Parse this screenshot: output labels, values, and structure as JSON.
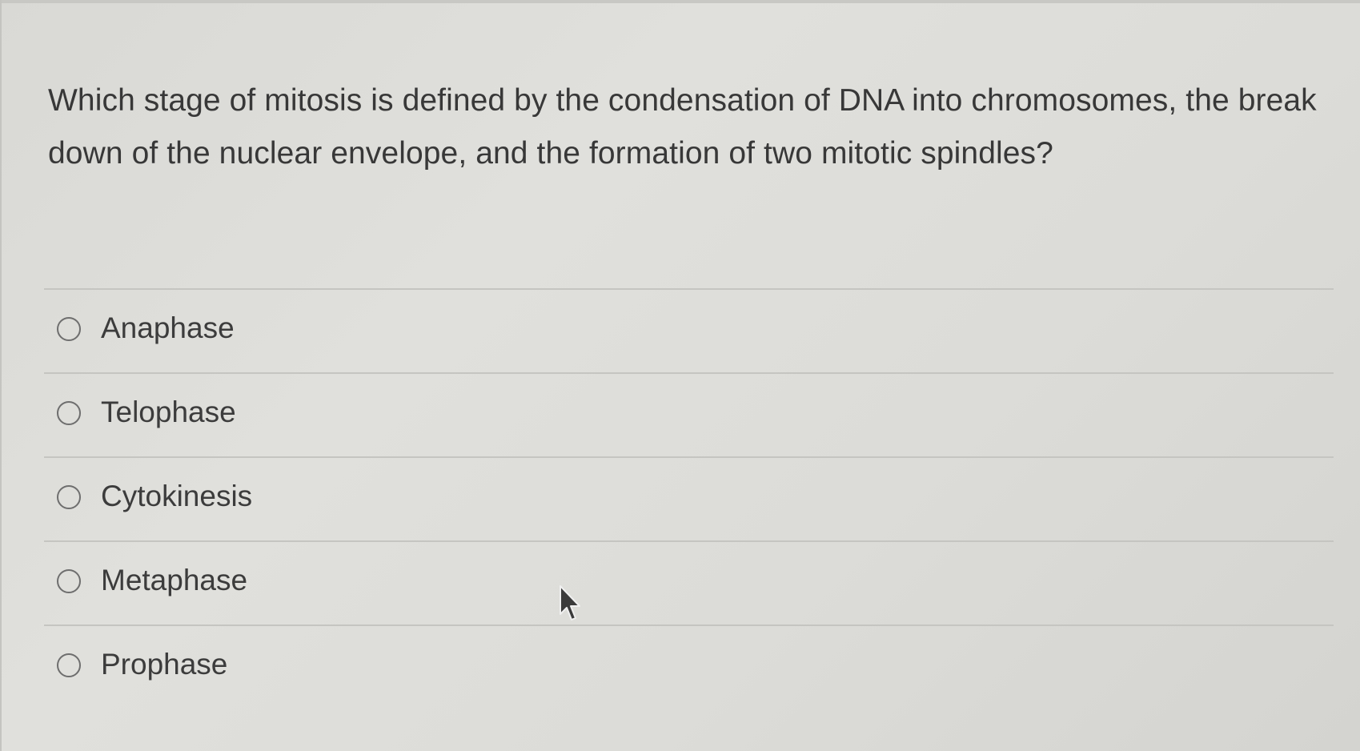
{
  "question": {
    "text": "Which stage of mitosis is defined by the condensation of DNA into chromosomes, the break down of the nuclear envelope, and the formation of two mitotic spindles?"
  },
  "options": [
    {
      "label": "Anaphase",
      "selected": false
    },
    {
      "label": "Telophase",
      "selected": false
    },
    {
      "label": "Cytokinesis",
      "selected": false
    },
    {
      "label": "Metaphase",
      "selected": false
    },
    {
      "label": "Prophase",
      "selected": false
    }
  ],
  "icons": {
    "cursor": "mouse-pointer-icon",
    "radio": "radio-button-icon"
  }
}
